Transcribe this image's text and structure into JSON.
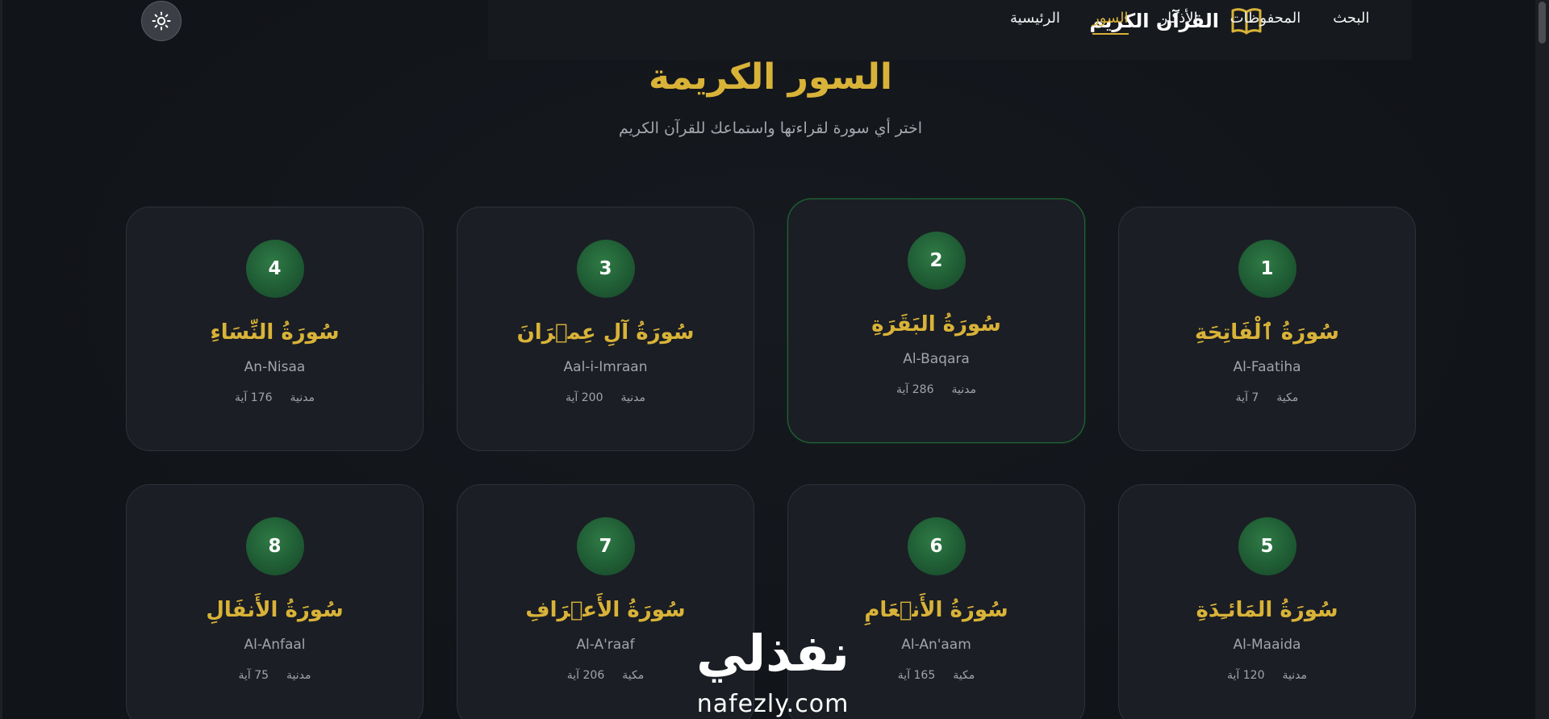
{
  "header": {
    "brand_title": "القرآن الكريم",
    "nav": [
      {
        "label": "الرئيسية",
        "active": false
      },
      {
        "label": "السور",
        "active": true
      },
      {
        "label": "الأذكار",
        "active": false
      },
      {
        "label": "المحفوظات",
        "active": false
      },
      {
        "label": "البحث",
        "active": false
      }
    ],
    "theme_icon": "sun-icon"
  },
  "main": {
    "title": "السور الكريمة",
    "subtitle": "اختر أي سورة لقراءتها واستماعك للقرآن الكريم"
  },
  "surahs": [
    {
      "number": "1",
      "name": "سُورَةُ ٱلْفَاتِحَةِ",
      "latin": "Al-Faatiha",
      "ayahs": "7 آية",
      "type": "مكية"
    },
    {
      "number": "2",
      "name": "سُورَةُ البَقَرَةِ",
      "latin": "Al-Baqara",
      "ayahs": "286 آية",
      "type": "مدنية"
    },
    {
      "number": "3",
      "name": "سُورَةُ آلِ عِمۡرَانَ",
      "latin": "Aal-i-Imraan",
      "ayahs": "200 آية",
      "type": "مدنية"
    },
    {
      "number": "4",
      "name": "سُورَةُ النِّسَاءِ",
      "latin": "An-Nisaa",
      "ayahs": "176 آية",
      "type": "مدنية"
    },
    {
      "number": "5",
      "name": "سُورَةُ المَائـِدَةِ",
      "latin": "Al-Maaida",
      "ayahs": "120 آية",
      "type": "مدنية"
    },
    {
      "number": "6",
      "name": "سُورَةُ الأَنۡعَامِ",
      "latin": "Al-An'aam",
      "ayahs": "165 آية",
      "type": "مكية"
    },
    {
      "number": "7",
      "name": "سُورَةُ الأَعۡرَافِ",
      "latin": "Al-A'raaf",
      "ayahs": "206 آية",
      "type": "مكية"
    },
    {
      "number": "8",
      "name": "سُورَةُ الأَنفَالِ",
      "latin": "Al-Anfaal",
      "ayahs": "75 آية",
      "type": "مدنية"
    }
  ],
  "watermark": {
    "arabic": "نفذلي",
    "url": "nafezly.com"
  },
  "colors": {
    "accent_gold": "#d9b338",
    "badge_green": "#1e5a33",
    "background": "#13161b",
    "card": "#1b1e24"
  }
}
